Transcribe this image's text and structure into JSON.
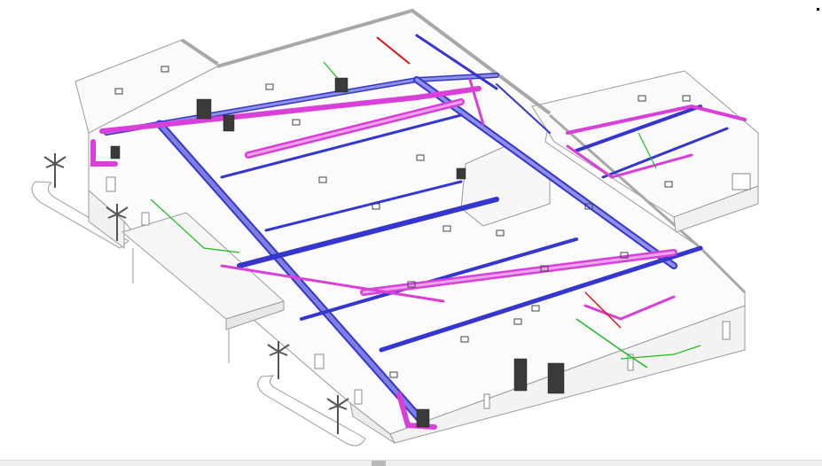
{
  "view": {
    "background": "#ffffff",
    "type": "3D isometric MEP model view"
  },
  "colors": {
    "building_outline": "#9a9a9a",
    "wall_face": "#f4f4f4",
    "supply_duct": "#3535d0",
    "supply_duct_fill": "#7f7fe0",
    "return_duct": "#d93fd9",
    "return_duct_fill": "#e9a0e9",
    "piping_green": "#1dbb1d",
    "equipment_dark": "#3a3a3a",
    "hot_pipe_red": "#e01010",
    "palm_tree": "#555555"
  },
  "scrollbar": {
    "position_fraction": 0.46
  },
  "systems": [
    {
      "name": "supply-air-ductwork",
      "icon": "supply-duct"
    },
    {
      "name": "return-air-ductwork",
      "icon": "return-duct"
    },
    {
      "name": "hydronic-piping",
      "icon": "pipe"
    },
    {
      "name": "mechanical-equipment",
      "icon": "equipment"
    }
  ]
}
